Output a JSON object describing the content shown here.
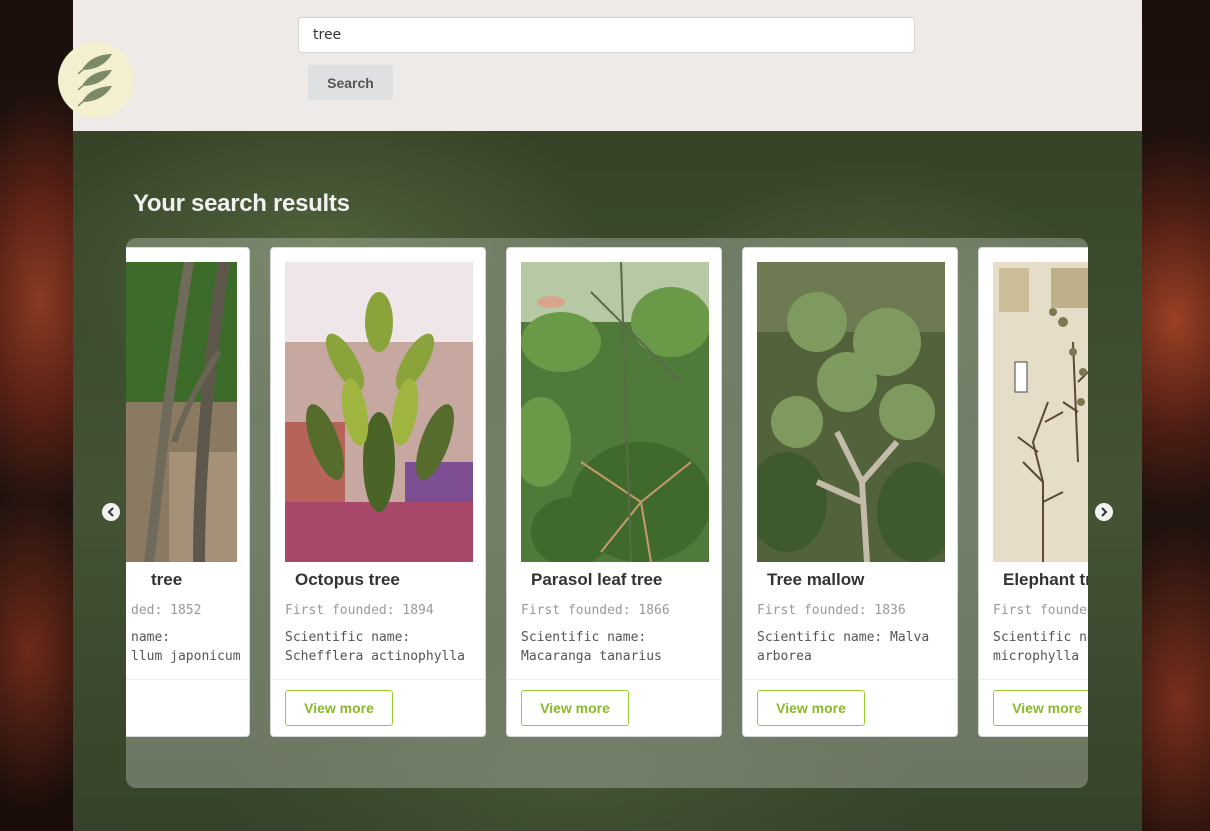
{
  "search": {
    "value": "tree",
    "button_label": "Search"
  },
  "results": {
    "title": "Your search results",
    "cards": [
      {
        "name": "tree",
        "founded": "ded: 1852",
        "sci_line1": "name:",
        "sci_line2": "llum japonicum",
        "button_label": "re"
      },
      {
        "name": "Octopus tree",
        "founded": "First founded: 1894",
        "sci_line1": "Scientific name:",
        "sci_line2": "Schefflera actinophylla",
        "button_label": "View more"
      },
      {
        "name": "Parasol leaf tree",
        "founded": "First founded: 1866",
        "sci_line1": "Scientific name:",
        "sci_line2": "Macaranga tanarius",
        "button_label": "View more"
      },
      {
        "name": "Tree mallow",
        "founded": "First founded: 1836",
        "sci_line1": "Scientific name: Malva",
        "sci_line2": "arborea",
        "button_label": "View more"
      },
      {
        "name": "Elephant tr",
        "founded": "First founded:",
        "sci_line1": "Scientific nam",
        "sci_line2": "microphylla",
        "button_label": "View more"
      }
    ]
  },
  "icons": {
    "logo": "leaf-logo-icon",
    "prev": "chevron-left-icon",
    "next": "chevron-right-icon"
  },
  "colors": {
    "accent": "#9acd32",
    "header_bg": "#eeeae7"
  }
}
